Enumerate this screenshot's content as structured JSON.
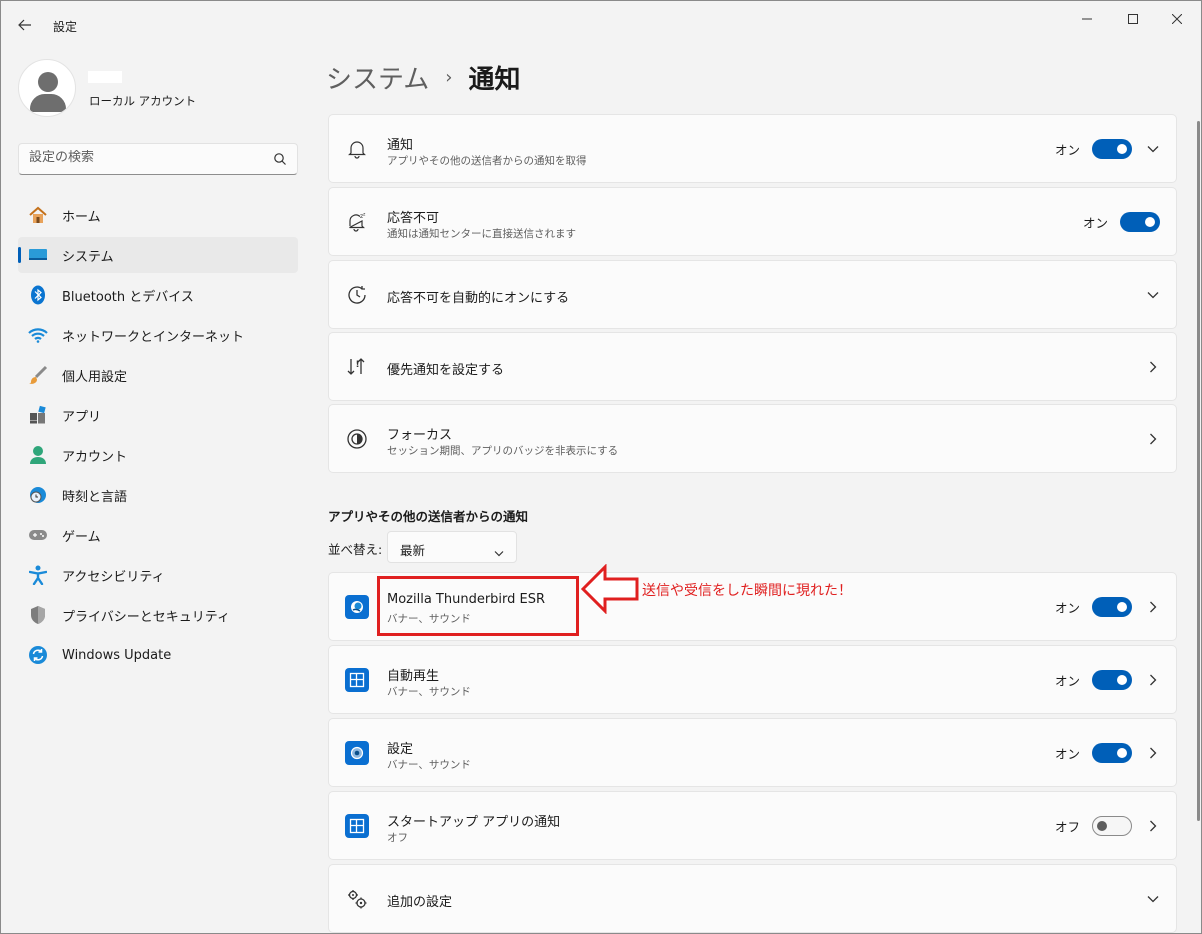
{
  "window": {
    "title": "設定",
    "controls": [
      "minimize",
      "maximize",
      "close"
    ]
  },
  "profile": {
    "account_type": "ローカル アカウント"
  },
  "search": {
    "placeholder": "設定の検索"
  },
  "sidebar": {
    "items": [
      {
        "label": "ホーム",
        "icon": "home-icon"
      },
      {
        "label": "システム",
        "icon": "system-icon",
        "active": true
      },
      {
        "label": "Bluetooth とデバイス",
        "icon": "bluetooth-icon"
      },
      {
        "label": "ネットワークとインターネット",
        "icon": "wifi-icon"
      },
      {
        "label": "個人用設定",
        "icon": "brush-icon"
      },
      {
        "label": "アプリ",
        "icon": "apps-icon"
      },
      {
        "label": "アカウント",
        "icon": "account-icon"
      },
      {
        "label": "時刻と言語",
        "icon": "time-language-icon"
      },
      {
        "label": "ゲーム",
        "icon": "gamepad-icon"
      },
      {
        "label": "アクセシビリティ",
        "icon": "accessibility-icon"
      },
      {
        "label": "プライバシーとセキュリティ",
        "icon": "shield-icon"
      },
      {
        "label": "Windows Update",
        "icon": "update-icon"
      }
    ]
  },
  "breadcrumb": {
    "parent": "システム",
    "separator": "›",
    "current": "通知"
  },
  "settings": {
    "notifications": {
      "title": "通知",
      "subtitle": "アプリやその他の送信者からの通知を取得",
      "state": "オン"
    },
    "dnd": {
      "title": "応答不可",
      "subtitle": "通知は通知センターに直接送信されます",
      "state": "オン"
    },
    "auto_dnd": {
      "title": "応答不可を自動的にオンにする"
    },
    "priority": {
      "title": "優先通知を設定する"
    },
    "focus": {
      "title": "フォーカス",
      "subtitle": "セッション期間、アプリのバッジを非表示にする"
    }
  },
  "senders": {
    "section_title": "アプリやその他の送信者からの通知",
    "sort_label": "並べ替え:",
    "sort_value": "最新",
    "apps": [
      {
        "name": "Mozilla Thunderbird ESR",
        "detail": "バナー、サウンド",
        "state": "オン",
        "on": true
      },
      {
        "name": "自動再生",
        "detail": "バナー、サウンド",
        "state": "オン",
        "on": true
      },
      {
        "name": "設定",
        "detail": "バナー、サウンド",
        "state": "オン",
        "on": true
      },
      {
        "name": "スタートアップ アプリの通知",
        "detail": "オフ",
        "state": "オフ",
        "on": false
      }
    ]
  },
  "additional": {
    "title": "追加の設定"
  },
  "annotation": {
    "text": "送信や受信をした瞬間に現れた！",
    "color": "#e02020"
  },
  "colors": {
    "accent": "#005fb8"
  }
}
